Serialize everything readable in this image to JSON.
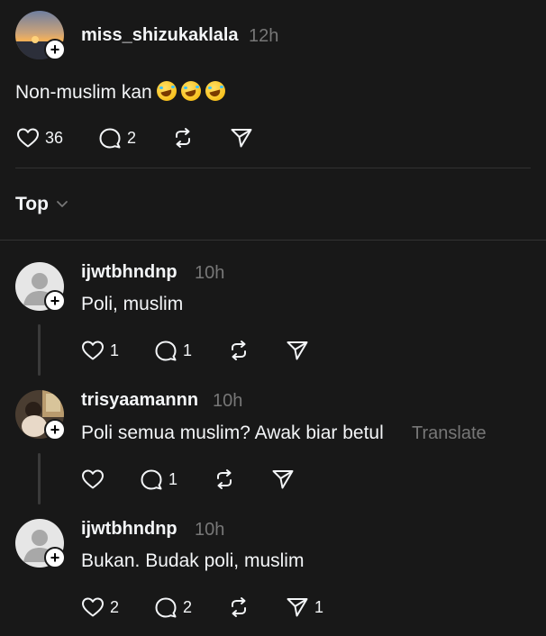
{
  "main_post": {
    "username": "miss_shizukaklala",
    "time": "12h",
    "text": "Non-muslim kan",
    "emojis": [
      "rolling-on-floor-laughing",
      "rolling-on-floor-laughing",
      "rolling-on-floor-laughing"
    ],
    "likes": "36",
    "replies": "2"
  },
  "sort": {
    "label": "Top"
  },
  "comments": [
    {
      "username": "ijwtbhndnp",
      "time": "10h",
      "text": "Poli, muslim",
      "likes": "1",
      "replies": "1",
      "shares": ""
    },
    {
      "username": "trisyaamannn",
      "time": "10h",
      "text": "Poli semua muslim? Awak biar betul",
      "translate": "Translate",
      "likes": "",
      "replies": "1",
      "shares": ""
    },
    {
      "username": "ijwtbhndnp",
      "time": "10h",
      "text": "Bukan. Budak poli, muslim",
      "likes": "2",
      "replies": "2",
      "shares": "1"
    }
  ],
  "colors": {
    "background": "#181818",
    "text": "#f3f5f7",
    "muted": "#777777",
    "divider": "#323232"
  }
}
